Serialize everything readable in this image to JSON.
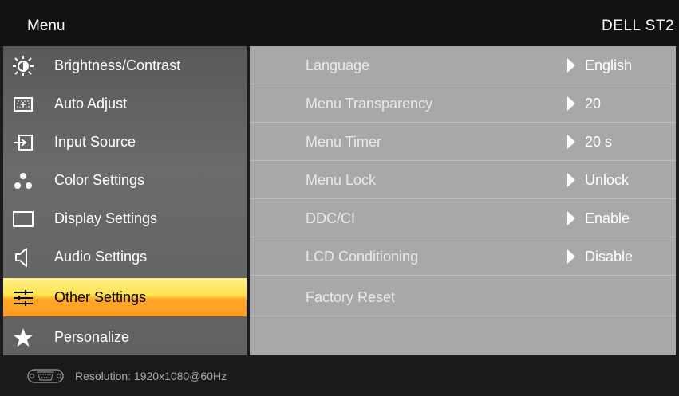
{
  "header": {
    "title": "Menu",
    "model": "DELL ST2"
  },
  "menu": [
    {
      "label": "Brightness/Contrast",
      "icon": "brightness-icon",
      "selected": false
    },
    {
      "label": "Auto Adjust",
      "icon": "auto-adjust-icon",
      "selected": false
    },
    {
      "label": "Input Source",
      "icon": "input-source-icon",
      "selected": false
    },
    {
      "label": "Color Settings",
      "icon": "color-settings-icon",
      "selected": false
    },
    {
      "label": "Display Settings",
      "icon": "display-settings-icon",
      "selected": false
    },
    {
      "label": "Audio Settings",
      "icon": "audio-settings-icon",
      "selected": false
    },
    {
      "label": "Other Settings",
      "icon": "other-settings-icon",
      "selected": true
    },
    {
      "label": "Personalize",
      "icon": "star-icon",
      "selected": false
    }
  ],
  "settings": [
    {
      "label": "Language",
      "value": "English"
    },
    {
      "label": "Menu Transparency",
      "value": "20"
    },
    {
      "label": "Menu Timer",
      "value": "20 s"
    },
    {
      "label": "Menu Lock",
      "value": "Unlock"
    },
    {
      "label": "DDC/CI",
      "value": "Enable"
    },
    {
      "label": "LCD Conditioning",
      "value": "Disable"
    },
    {
      "label": "Factory Reset",
      "value": ""
    }
  ],
  "status": {
    "icon": "vga-connector-icon",
    "resolution": "Resolution:  1920x1080@60Hz"
  },
  "colors": {
    "highlight_top": "#ffe24a",
    "highlight_bottom": "#ff9b1f",
    "menu_bg": "#636363",
    "panel_bg": "#a8a8a8"
  }
}
